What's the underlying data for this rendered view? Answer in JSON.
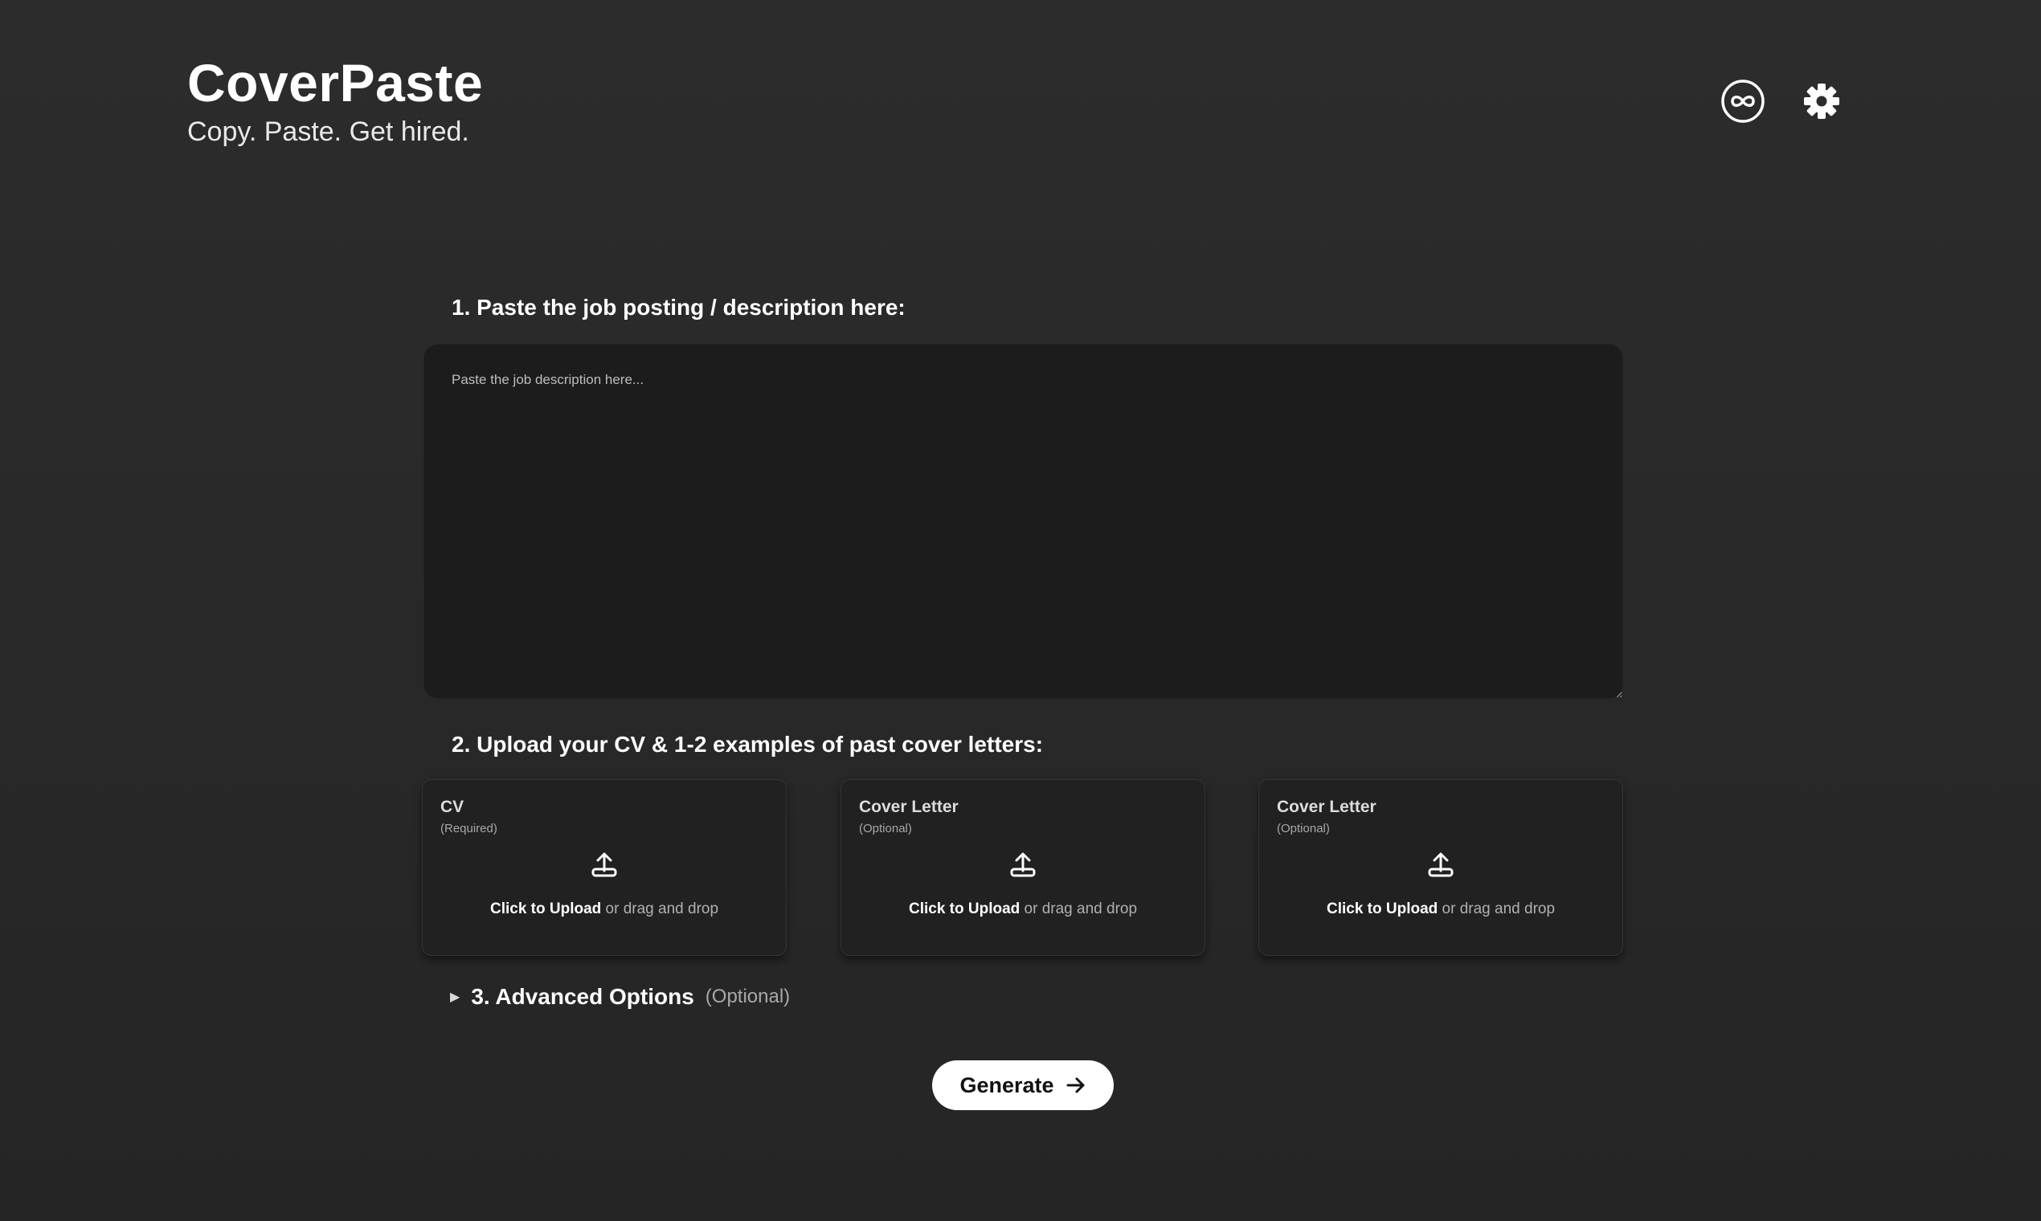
{
  "header": {
    "title": "CoverPaste",
    "tagline": "Copy. Paste. Get hired.",
    "icons": [
      "infinity-icon",
      "gear-icon"
    ]
  },
  "step1": {
    "label": "1. Paste the job posting / description here:",
    "placeholder": "Paste the job description here...",
    "value": ""
  },
  "step2": {
    "label": "2. Upload your CV & 1-2 examples of past cover letters:",
    "cards": [
      {
        "title": "CV",
        "subtitle": "(Required)",
        "click_text": "Click to Upload",
        "rest_text": " or drag and drop"
      },
      {
        "title": "Cover Letter",
        "subtitle": "(Optional)",
        "click_text": "Click to Upload",
        "rest_text": " or drag and drop"
      },
      {
        "title": "Cover Letter",
        "subtitle": "(Optional)",
        "click_text": "Click to Upload",
        "rest_text": " or drag and drop"
      }
    ]
  },
  "step3": {
    "arrow": "▶",
    "label": "3. Advanced Options",
    "optional": "(Optional)"
  },
  "generate": {
    "label": "Generate",
    "icon": "arrow-right-icon"
  },
  "colors": {
    "background": "#2c2c2c",
    "textarea": "#1c1c1c",
    "card": "#212121",
    "button": "#ffffff"
  }
}
